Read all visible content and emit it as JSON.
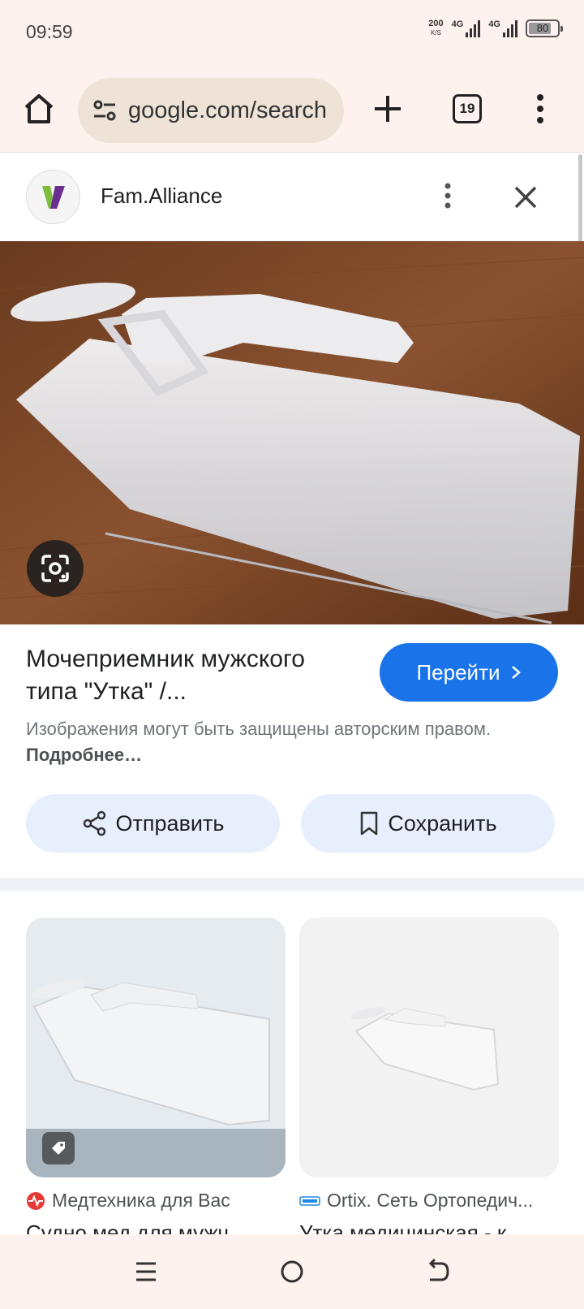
{
  "status_bar": {
    "time": "09:59",
    "net_speed": "200",
    "net_speed_unit": "K/S",
    "sim1_label": "4G",
    "sim2_label": "4G",
    "battery": "80"
  },
  "browser": {
    "url": "google.com/search",
    "tab_count": "19"
  },
  "source": {
    "name": "Fam.Alliance"
  },
  "result": {
    "title": "Мочеприемник мужского типа \"Утка\" /...",
    "visit_label": "Перейти",
    "copyright_text": "Изображения могут быть защищены авторским правом.",
    "more_label": "Подробнее…",
    "share_label": "Отправить",
    "save_label": "Сохранить"
  },
  "related": [
    {
      "source": "Медтехника для Вас",
      "title": "Судно мед для мужч..."
    },
    {
      "source": "Ortix. Сеть Ортопедич...",
      "title": "Утка медицинская - к..."
    }
  ],
  "colors": {
    "accent": "#1a73e8",
    "chrome_bg": "#fdf2ee",
    "chip_bg": "#e8effc"
  }
}
